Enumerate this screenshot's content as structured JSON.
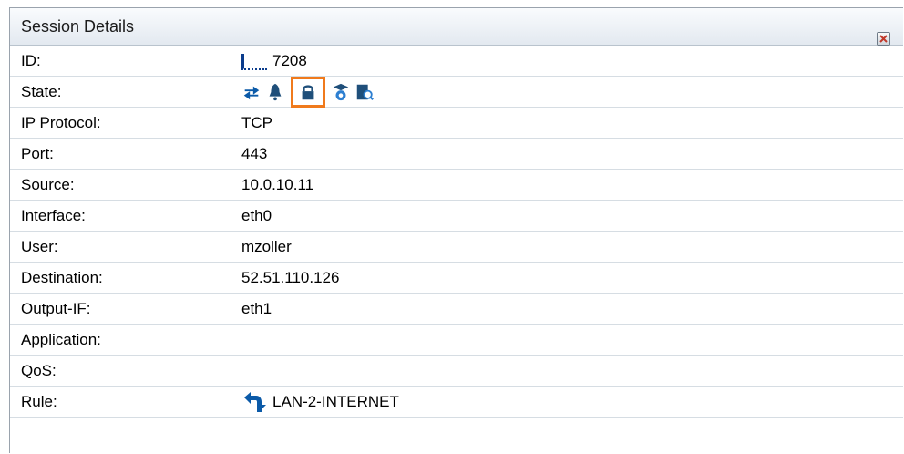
{
  "panel": {
    "title": "Session Details",
    "close_icon": "close-icon"
  },
  "rows": {
    "id": {
      "label": "ID:",
      "value": "7208"
    },
    "state": {
      "label": "State:",
      "icons": [
        "bidirectional-arrows-icon",
        "bell-icon",
        "lock-icon",
        "shield-gear-icon",
        "document-search-icon"
      ],
      "highlighted_icon": "lock-icon"
    },
    "ip_protocol": {
      "label": "IP Protocol:",
      "value": "TCP"
    },
    "port": {
      "label": "Port:",
      "value": "443"
    },
    "source": {
      "label": "Source:",
      "value": "10.0.10.11"
    },
    "interface": {
      "label": "Interface:",
      "value": "eth0"
    },
    "user": {
      "label": "User:",
      "value": "mzoller"
    },
    "destination": {
      "label": "Destination:",
      "value": "52.51.110.126"
    },
    "output_if": {
      "label": "Output-IF:",
      "value": "eth1"
    },
    "application": {
      "label": "Application:",
      "value": ""
    },
    "qos": {
      "label": "QoS:",
      "value": ""
    },
    "rule": {
      "label": "Rule:",
      "value": "LAN-2-INTERNET",
      "icon": "rule-arrow-icon"
    }
  },
  "colors": {
    "icon_blue": "#0b5aa8",
    "highlight_orange": "#f07a1c",
    "grid_line": "#d6dde3"
  }
}
